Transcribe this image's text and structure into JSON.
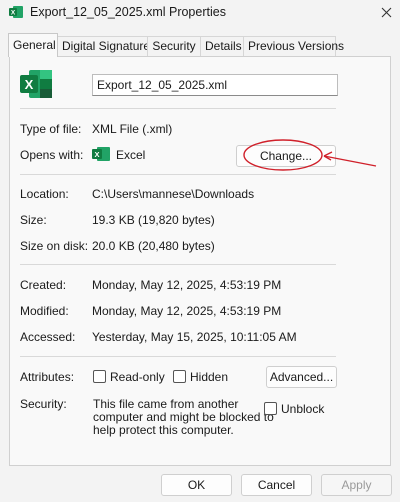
{
  "window": {
    "title": "Export_12_05_2025.xml Properties",
    "close_glyph": "✕"
  },
  "tabs": [
    {
      "label": "General",
      "active": true
    },
    {
      "label": "Digital Signatures",
      "active": false
    },
    {
      "label": "Security",
      "active": false
    },
    {
      "label": "Details",
      "active": false
    },
    {
      "label": "Previous Versions",
      "active": false
    }
  ],
  "general": {
    "app_icon": "excel-icon",
    "file_name": "Export_12_05_2025.xml",
    "type_of_file_label": "Type of file:",
    "type_of_file_value": "XML File (.xml)",
    "opens_with_label": "Opens with:",
    "opens_with_value": "Excel",
    "change_button": "Change...",
    "location_label": "Location:",
    "location_value": "C:\\Users\\mannese\\Downloads",
    "size_label": "Size:",
    "size_value": "19.3 KB (19,820 bytes)",
    "size_on_disk_label": "Size on disk:",
    "size_on_disk_value": "20.0 KB (20,480 bytes)",
    "created_label": "Created:",
    "created_value": "Monday, May 12, 2025, 4:53:19 PM",
    "modified_label": "Modified:",
    "modified_value": "Monday, May 12, 2025, 4:53:19 PM",
    "accessed_label": "Accessed:",
    "accessed_value": "Yesterday, May 15, 2025, 10:11:05 AM",
    "attributes_label": "Attributes:",
    "readonly_label": "Read-only",
    "readonly_checked": false,
    "hidden_label": "Hidden",
    "hidden_checked": false,
    "advanced_button": "Advanced...",
    "security_label": "Security:",
    "security_text_1": "This file came from another",
    "security_text_2": "computer and might be blocked to",
    "security_text_3": "help protect this computer.",
    "unblock_label": "Unblock",
    "unblock_checked": false
  },
  "footer": {
    "ok": "OK",
    "cancel": "Cancel",
    "apply": "Apply"
  },
  "annotation": {
    "color": "#d0202a",
    "target": "change-button"
  },
  "colors": {
    "excel_green": "#107c41",
    "excel_dark": "#185c37"
  }
}
